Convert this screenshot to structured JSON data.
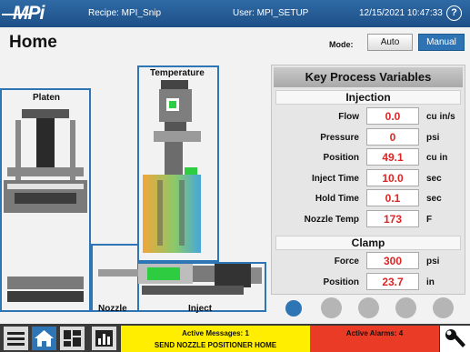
{
  "topbar": {
    "logo": "MPi",
    "recipe": "Recipe: MPI_Snip",
    "user": "User: MPI_SETUP",
    "datetime": "12/15/2021  10:47:33",
    "help_glyph": "?"
  },
  "header": {
    "title": "Home",
    "mode_label": "Mode:",
    "mode_options": [
      "Auto",
      "Manual"
    ],
    "mode_selected": "Manual"
  },
  "diagram": {
    "temperature_label": "Temperature",
    "platen_label": "Platen",
    "nozzle_label": "Nozzle",
    "inject_label": "Inject"
  },
  "kpv": {
    "title": "Key Process Variables",
    "injection": {
      "header": "Injection",
      "rows": [
        {
          "label": "Flow",
          "value": "0.0",
          "unit": "cu in/s"
        },
        {
          "label": "Pressure",
          "value": "0",
          "unit": "psi"
        },
        {
          "label": "Position",
          "value": "49.1",
          "unit": "cu in"
        },
        {
          "label": "Inject Time",
          "value": "10.0",
          "unit": "sec"
        },
        {
          "label": "Hold Time",
          "value": "0.1",
          "unit": "sec"
        },
        {
          "label": "Nozzle Temp",
          "value": "173",
          "unit": "F"
        }
      ]
    },
    "clamp": {
      "header": "Clamp",
      "rows": [
        {
          "label": "Force",
          "value": "300",
          "unit": "psi"
        },
        {
          "label": "Position",
          "value": "23.7",
          "unit": "in"
        }
      ]
    }
  },
  "pager": {
    "count": 5,
    "active_index": 0
  },
  "footer": {
    "nav_icons": [
      "menu-icon",
      "home-icon",
      "dashboard-icon",
      "chart-icon"
    ],
    "active_nav": "home-icon",
    "messages_title": "Active Messages: 1",
    "messages_text": "SEND NOZZLE POSITIONER HOME",
    "alarms_title": "Active Alarms: 4",
    "settings_icon": "wrench-icon"
  },
  "colors": {
    "topbar": "#1d4f86",
    "accent": "#2e75b6",
    "value_text": "#e02424",
    "messages_bg": "#ffee00",
    "alarms_bg": "#ea3b26"
  }
}
